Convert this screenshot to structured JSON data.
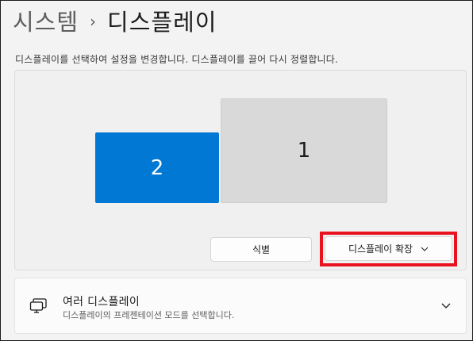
{
  "breadcrumb": {
    "parent": "시스템",
    "separator": "›",
    "current": "디스플레이"
  },
  "description": "디스플레이를 선택하여 설정을 변경합니다. 디스플레이를 끌어 다시 정렬합니다.",
  "arrangement": {
    "monitors": [
      {
        "label": "2",
        "selected": true
      },
      {
        "label": "1",
        "selected": false
      }
    ],
    "identify_button": "식별",
    "mode_dropdown": {
      "value": "디스플레이 확장",
      "icon": "chevron-down-icon"
    }
  },
  "multiple_displays": {
    "title": "여러 디스플레이",
    "subtitle": "디스플레이의 프레젠테이션 모드를 선택합니다.",
    "icon": "multi-display-icon",
    "expand_icon": "chevron-down-icon"
  },
  "colors": {
    "accent": "#0078d4",
    "highlight": "#e8131f"
  }
}
